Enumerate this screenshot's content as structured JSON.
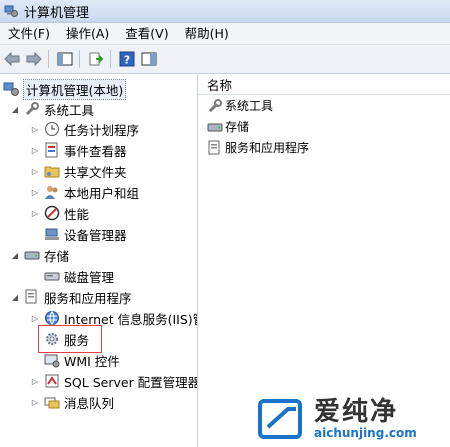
{
  "window": {
    "title": "计算机管理"
  },
  "menu": [
    "文件(F)",
    "操作(A)",
    "查看(V)",
    "帮助(H)"
  ],
  "toolbar": {
    "buttons": [
      "back-icon",
      "forward-icon",
      "console-tree-icon",
      "export-icon",
      "help-icon",
      "properties-icon"
    ]
  },
  "tree": {
    "root": "计算机管理(本地)",
    "system_tools": "系统工具",
    "task_scheduler": "任务计划程序",
    "event_viewer": "事件查看器",
    "shared_folders": "共享文件夹",
    "local_users": "本地用户和组",
    "performance": "性能",
    "device_manager": "设备管理器",
    "storage": "存储",
    "disk_management": "磁盘管理",
    "services_apps": "服务和应用程序",
    "iis": "Internet 信息服务(IIS)管",
    "services": "服务",
    "wmi": "WMI 控件",
    "sql_server": "SQL Server 配置管理器",
    "message_queue": "消息队列"
  },
  "right_pane": {
    "column_header": "名称",
    "items": [
      "系统工具",
      "存储",
      "服务和应用程序"
    ]
  },
  "watermark": {
    "brand": "爱纯净",
    "url": "aichunjing.com"
  },
  "colors": {
    "highlight_border": "#e0403f",
    "watermark_blue": "#1a73c8"
  }
}
